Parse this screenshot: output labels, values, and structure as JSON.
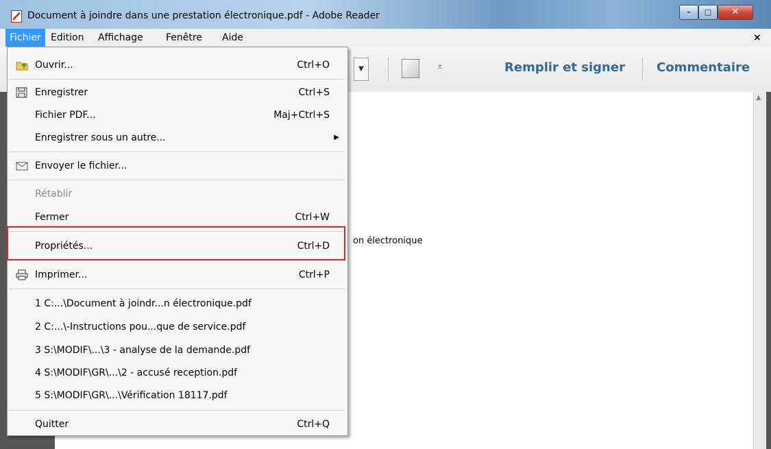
{
  "window": {
    "title": "Document à joindre dans une prestation électronique.pdf - Adobe Reader",
    "minimize": "–",
    "maximize": "□",
    "close": "✕"
  },
  "menubar": {
    "items": [
      "Fichier",
      "Edition",
      "Affichage",
      "Fenêtre",
      "Aide"
    ],
    "doc_close": "×"
  },
  "toolbar": {
    "fill_sign": "Remplir et signer",
    "comment": "Commentaire",
    "dropdown_arrow": "▼",
    "overflow": "⩡"
  },
  "document": {
    "visible_text": "on électronique"
  },
  "file_menu": {
    "items": [
      {
        "label": "Ouvrir...",
        "shortcut": "Ctrl+O",
        "icon": "open-folder-icon"
      },
      {
        "label": "Enregistrer",
        "shortcut": "Ctrl+S",
        "icon": "save-icon"
      },
      {
        "label": "Fichier PDF...",
        "shortcut": "Maj+Ctrl+S"
      },
      {
        "label": "Enregistrer sous un autre...",
        "shortcut": "",
        "submenu": true
      },
      {
        "label": "Envoyer le fichier...",
        "shortcut": "",
        "icon": "envelope-icon"
      },
      {
        "label": "Rétablir",
        "shortcut": "",
        "disabled": true
      },
      {
        "label": "Fermer",
        "shortcut": "Ctrl+W"
      },
      {
        "label": "Propriétés...",
        "shortcut": "Ctrl+D",
        "highlighted": true
      },
      {
        "label": "Imprimer...",
        "shortcut": "Ctrl+P",
        "icon": "printer-icon"
      },
      {
        "label": "1 C:...\\Document à joindr...n électronique.pdf",
        "shortcut": ""
      },
      {
        "label": "2 C:...\\-Instructions pou...que de service.pdf",
        "shortcut": ""
      },
      {
        "label": "3 S:\\MODIF\\...\\3 - analyse de la demande.pdf",
        "shortcut": ""
      },
      {
        "label": "4 S:\\MODIF\\GR\\...\\2 - accusé reception.pdf",
        "shortcut": ""
      },
      {
        "label": "5 S:\\MODIF\\GR\\...\\Vérification 18117.pdf",
        "shortcut": ""
      },
      {
        "label": "Quitter",
        "shortcut": "Ctrl+Q"
      }
    ],
    "submenu_arrow": "▶"
  },
  "colors": {
    "menu_active": "#3399ff",
    "highlight_box": "#e02424",
    "toolbar_link": "#34689a"
  }
}
